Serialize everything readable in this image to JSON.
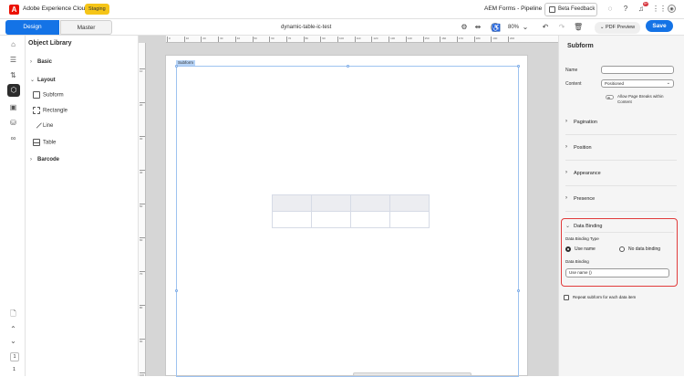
{
  "app": {
    "name": "Adobe Experience Cloud",
    "env_badge": "Staging",
    "org": "AEM Forms - Pipeline",
    "beta_feedback": "Beta Feedback",
    "notification_count": "9+",
    "logo_letter": "A"
  },
  "toolbar": {
    "tabs": [
      {
        "label": "Design",
        "active": true
      },
      {
        "label": "Master",
        "active": false
      }
    ],
    "document_name": "dynamic-table-ic-test",
    "zoom": "80%",
    "pdf_preview": "PDF Preview",
    "save": "Save"
  },
  "library": {
    "title": "Object Library",
    "groups": [
      {
        "label": "Basic",
        "expanded": false
      },
      {
        "label": "Layout",
        "expanded": true,
        "items": [
          "Subform",
          "Rectangle",
          "Line",
          "Table"
        ]
      },
      {
        "label": "Barcode",
        "expanded": false
      }
    ]
  },
  "rail": {
    "page_number": "1",
    "page_total": "1"
  },
  "canvas": {
    "subform_tag": "Subform",
    "ruler_h": [
      "0",
      "10",
      "20",
      "30",
      "40",
      "50",
      "60",
      "70",
      "80",
      "90",
      "100",
      "110",
      "120",
      "130",
      "140",
      "150",
      "160",
      "170",
      "180",
      "190",
      "200"
    ],
    "ruler_v": [
      "10",
      "20",
      "30",
      "40",
      "50",
      "60",
      "70",
      "80",
      "90",
      "100"
    ]
  },
  "properties": {
    "title": "Subform",
    "name_label": "Name",
    "name_value": "",
    "content_label": "Content",
    "content_value": "Positioned",
    "allow_breaks": "Allow Page Breaks within Content",
    "sections": [
      "Pagination",
      "Position",
      "Appearance",
      "Presence"
    ],
    "data_binding": {
      "title": "Data Binding",
      "type_label": "Data Binding Type",
      "option_use_name": "Use name",
      "option_no_binding": "No data binding",
      "binding_label": "Data Binding",
      "binding_value": "Use name ()"
    },
    "repeat_label": "Repeat subform for each data item"
  },
  "colors": {
    "accent": "#1473e6",
    "highlight": "#e13b3b",
    "badge": "#f5c518"
  }
}
